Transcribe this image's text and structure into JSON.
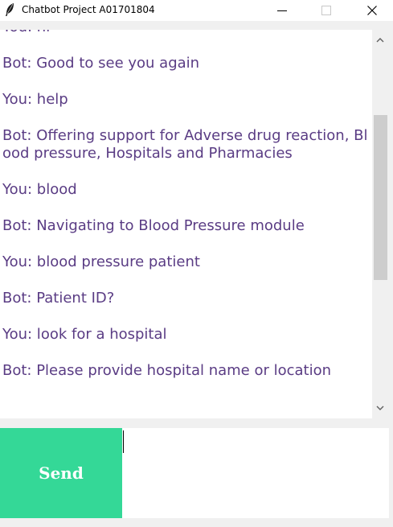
{
  "window": {
    "title": "Chatbot Project A01701804",
    "icons": {
      "app": "feather-icon",
      "minimize": "minimize-icon",
      "maximize": "maximize-icon",
      "close": "close-icon"
    }
  },
  "chat": {
    "messages": [
      "You: hi",
      "Bot: Good to see you again",
      "You: help",
      "Bot: Offering support for Adverse drug reaction, Blood pressure, Hospitals and Pharmacies",
      "You: blood",
      "Bot: Navigating to Blood Pressure module",
      "You: blood pressure patient",
      "Bot: Patient ID?",
      "You: look for a hospital",
      "Bot: Please provide hospital name or location"
    ],
    "text_color": "#5a3c84"
  },
  "input": {
    "send_label": "Send",
    "value": "",
    "button_color": "#34d897"
  }
}
